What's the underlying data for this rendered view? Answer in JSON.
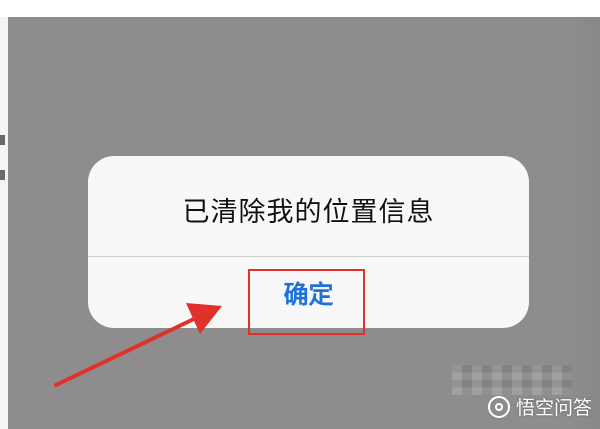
{
  "alert": {
    "message": "已清除我的位置信息",
    "confirm_label": "确定"
  },
  "watermark": {
    "text": "悟空问答",
    "logo": "wukong-logo-icon"
  },
  "colors": {
    "overlay": "#8e8c8d",
    "alert_background": "#f8f8f8",
    "button_text": "#1f73d8",
    "annotation_red": "#e0312a"
  }
}
